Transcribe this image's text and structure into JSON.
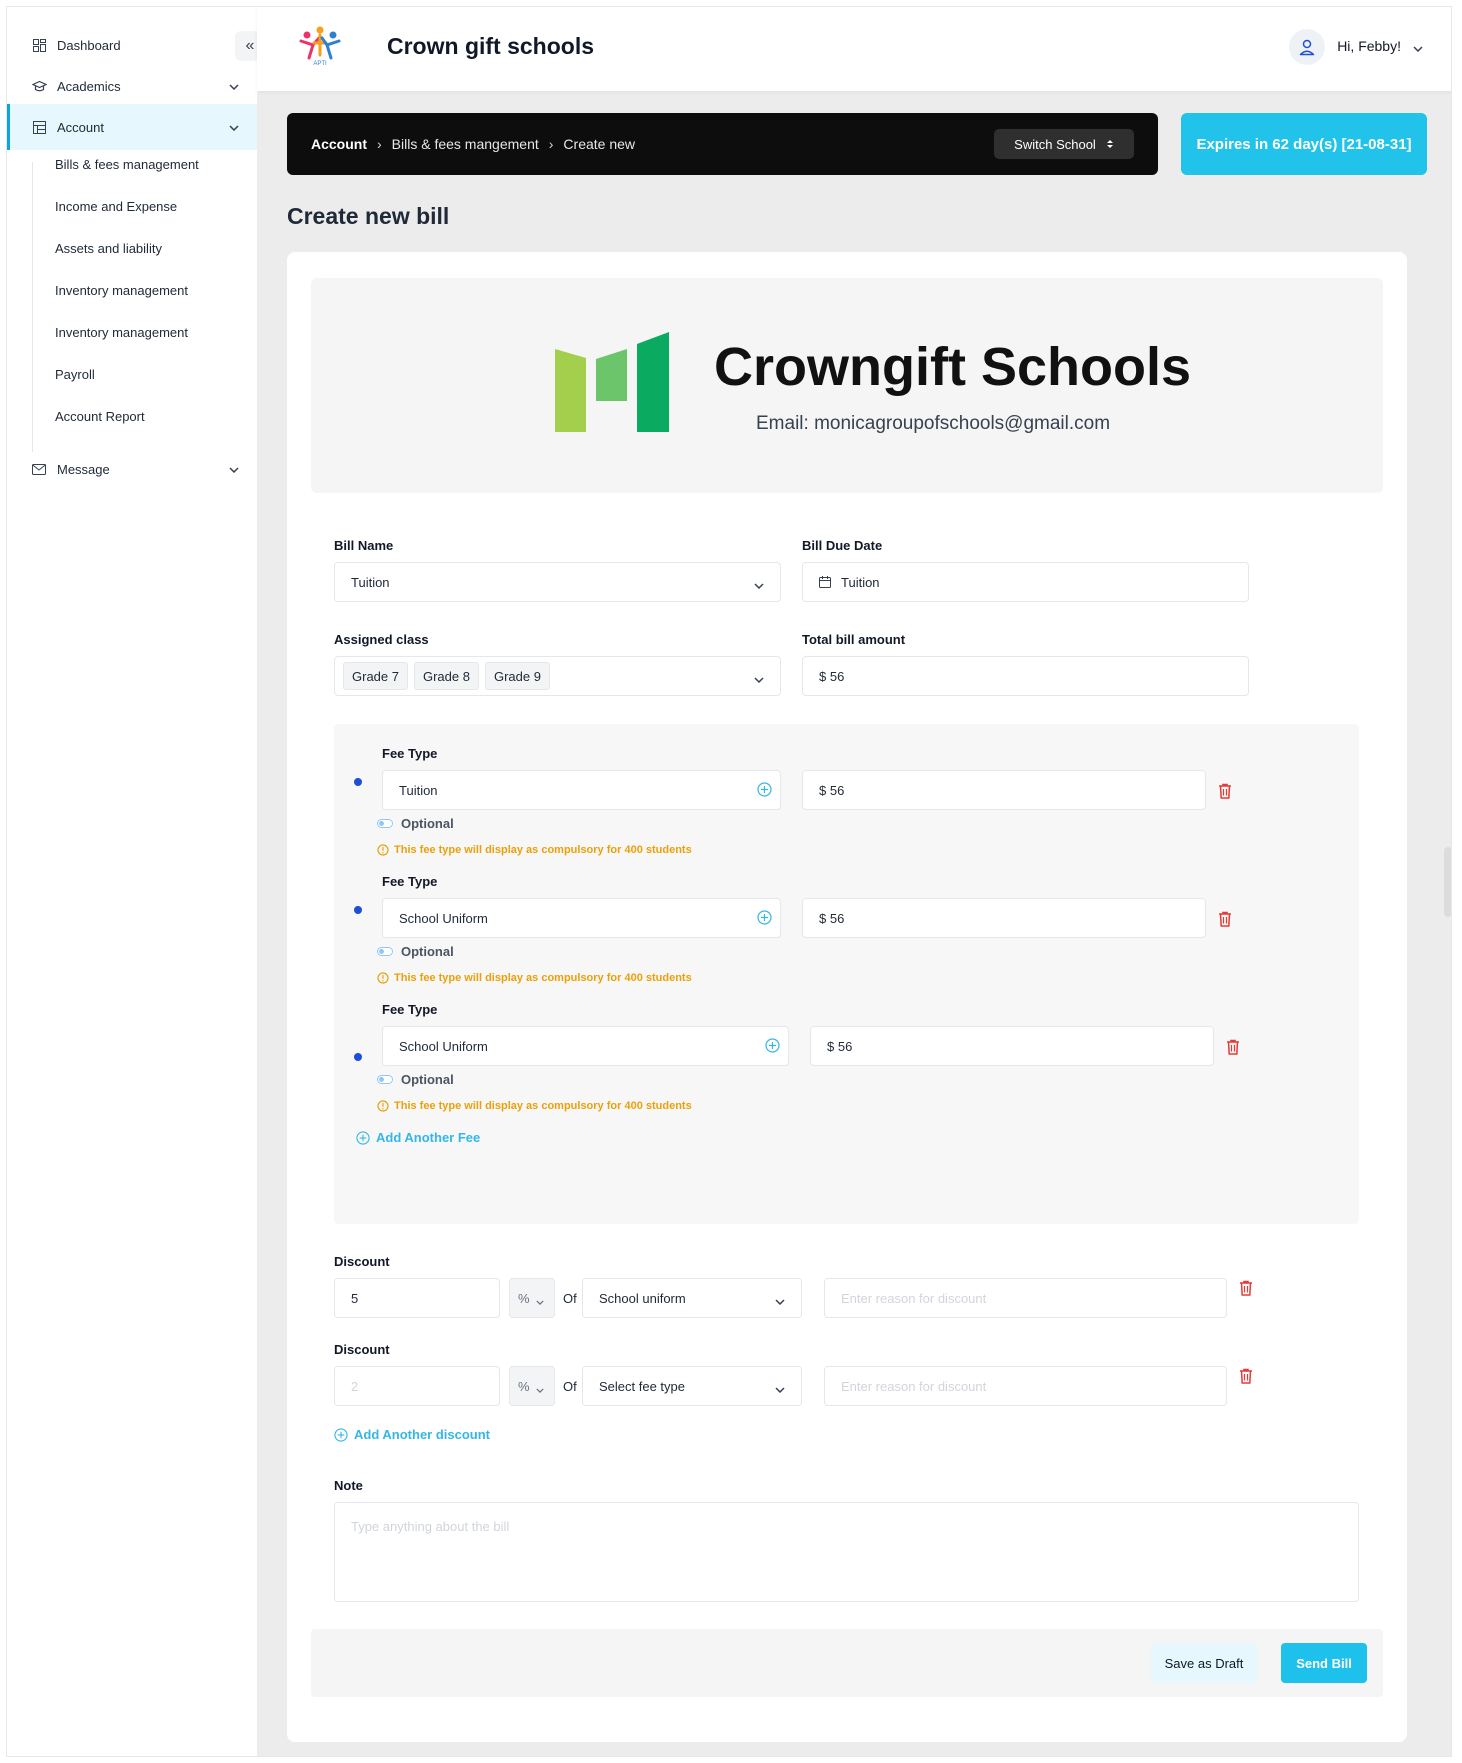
{
  "sidebar": {
    "collapse_label": "«",
    "items": [
      {
        "label": "Dashboard",
        "icon": "dashboard-icon"
      },
      {
        "label": "Academics",
        "icon": "graduation-cap-icon"
      },
      {
        "label": "Account",
        "icon": "ledger-icon"
      },
      {
        "label": "Message",
        "icon": "mail-icon"
      }
    ],
    "account_subitems": [
      "Bills & fees management",
      "Income and Expense",
      "Assets and liability",
      "Inventory management",
      "Inventory management",
      "Payroll",
      "Account Report"
    ]
  },
  "header": {
    "brand_name": "Crown gift schools",
    "brand_logo_text": "APTI",
    "greeting": "Hi, Febby!"
  },
  "breadcrumb": {
    "items": [
      "Account",
      "Bills & fees mangement",
      "Create new"
    ],
    "separator": "›",
    "switch_label": "Switch School"
  },
  "expires_label": "Expires in 62 day(s) [21-08-31]",
  "page_title": "Create new bill",
  "school": {
    "name": "Crowngift Schools",
    "email": "Email: monicagroupofschools@gmail.com"
  },
  "form": {
    "bill_name": {
      "label": "Bill Name",
      "value": "Tuition"
    },
    "due_date": {
      "label": "Bill Due Date",
      "value": "Tuition"
    },
    "assigned_class": {
      "label": "Assigned class",
      "chips": [
        "Grade 7",
        "Grade 8",
        "Grade 9"
      ]
    },
    "total_amount": {
      "label": "Total bill amount",
      "value": "$ 56"
    },
    "fees": [
      {
        "label": "Fee Type",
        "value": "Tuition",
        "amount": "$ 56",
        "optional_label": "Optional",
        "warning": "This fee type will display as compulsory for 400 students"
      },
      {
        "label": "Fee Type",
        "value": "School Uniform",
        "amount": "$ 56",
        "optional_label": "Optional",
        "warning": "This fee type will display as compulsory for 400 students"
      },
      {
        "label": "Fee Type",
        "value": "School Uniform",
        "amount": "$ 56",
        "optional_label": "Optional",
        "warning": "This fee type will display as compulsory for 400 students"
      }
    ],
    "add_fee_label": "Add Another Fee",
    "discounts": [
      {
        "label": "Discount",
        "value": "5",
        "value_is_placeholder": false,
        "unit": "%",
        "of_label": "Of",
        "fee_type": "School uniform",
        "reason_placeholder": "Enter reason for discount"
      },
      {
        "label": "Discount",
        "value": "2",
        "value_is_placeholder": true,
        "unit": "%",
        "of_label": "Of",
        "fee_type": "Select fee type",
        "reason_placeholder": "Enter reason for discount"
      }
    ],
    "add_discount_label": "Add Another discount",
    "note": {
      "label": "Note",
      "placeholder": "Type anything about the bill"
    }
  },
  "actions": {
    "draft_label": "Save as Draft",
    "send_label": "Send Bill"
  },
  "colors": {
    "accent": "#1ec0ec",
    "expires_bg": "#21c3ea",
    "warning": "#eaa10b",
    "danger": "#e53935",
    "link": "#34b7e6",
    "logo_light": "#a3cf4d",
    "logo_mid": "#6cc56a",
    "logo_dark": "#0aaa60"
  }
}
